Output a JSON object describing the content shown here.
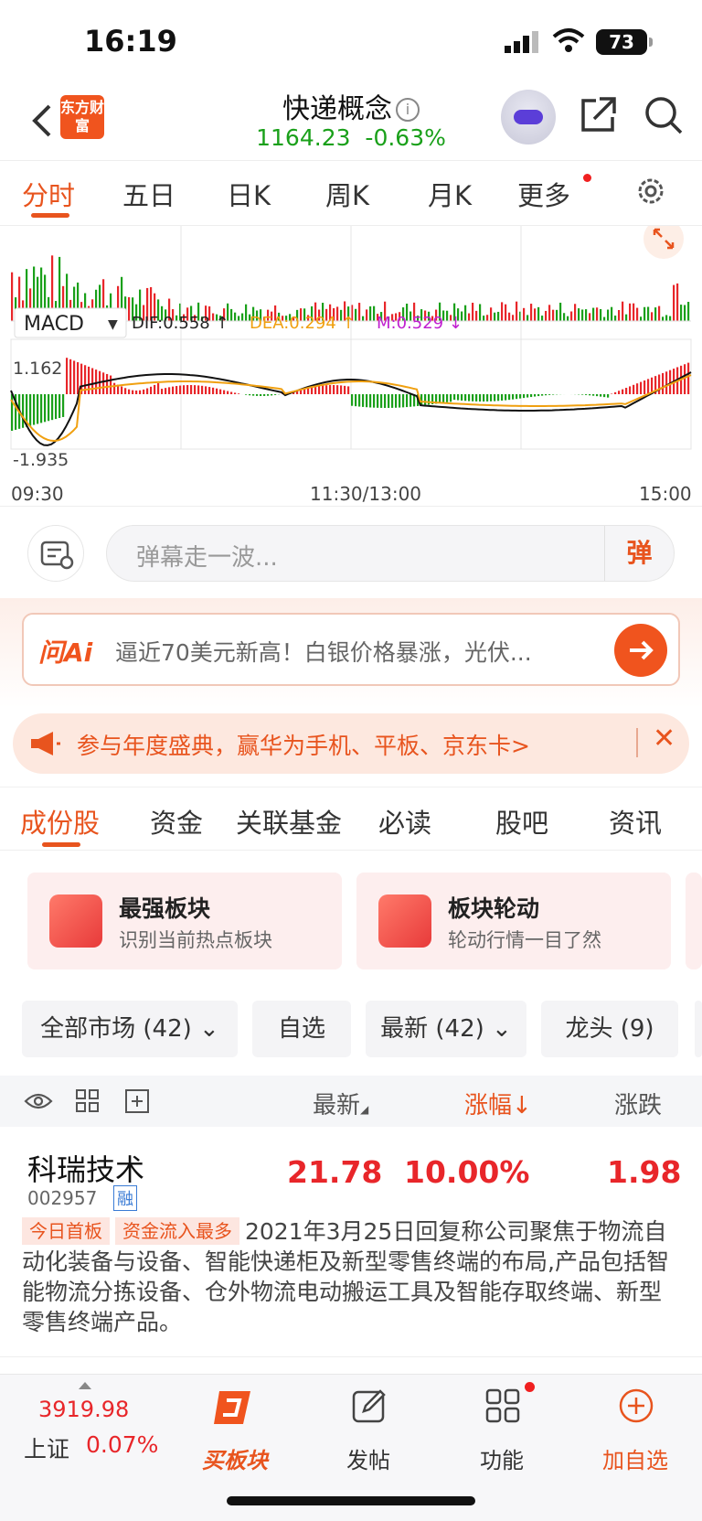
{
  "status": {
    "time": "16:19",
    "battery": "73"
  },
  "header": {
    "logo": "东方财富",
    "title": "快递概念",
    "price": "1164.23",
    "change": "-0.63%"
  },
  "chart_tabs": [
    "分时",
    "五日",
    "日K",
    "周K",
    "月K",
    "更多"
  ],
  "macd": {
    "indicator": "MACD",
    "dif": "DIF:0.558 ↑",
    "dea": "DEA:0.294 ↑",
    "m": "M:0.529 ↓",
    "y_top": "1.162",
    "y_bottom": "-1.935",
    "x_labels": [
      "09:30",
      "11:30/13:00",
      "15:00"
    ]
  },
  "danmu": {
    "placeholder": "弹幕走一波...",
    "button": "弹"
  },
  "ai": {
    "logo": "问Ai",
    "text": "逼近70美元新高！白银价格暴涨，光伏..."
  },
  "promo": {
    "text": "参与年度盛典，赢华为手机、平板、京东卡>"
  },
  "sub_tabs": [
    "成份股",
    "资金",
    "关联基金",
    "必读",
    "股吧",
    "资讯"
  ],
  "cards": [
    {
      "title": "最强板块",
      "subtitle": "识别当前热点板块"
    },
    {
      "title": "板块轮动",
      "subtitle": "轮动行情一目了然"
    }
  ],
  "filters": [
    "全部市场 (42)",
    "自选",
    "最新 (42)",
    "龙头 (9)"
  ],
  "table_header": {
    "latest": "最新",
    "change_pct": "涨幅",
    "change": "涨跌"
  },
  "stock": {
    "name": "科瑞技术",
    "code": "002957",
    "margin": "融",
    "latest": "21.78",
    "change_pct": "10.00%",
    "change": "1.98",
    "tags": [
      "今日首板",
      "资金流入最多"
    ],
    "desc": "2021年3月25日回复称公司聚焦于物流自动化装备与设备、智能快递柜及新型零售终端的布局,产品包括智能物流分拣设备、仓外物流电动搬运工具及智能存取终端、新型零售终端产品。"
  },
  "bottom": {
    "index_value": "3919.98",
    "index_name": "上证",
    "index_change": "0.07%",
    "buy": "买板块",
    "post": "发帖",
    "func": "功能",
    "add": "加自选"
  }
}
